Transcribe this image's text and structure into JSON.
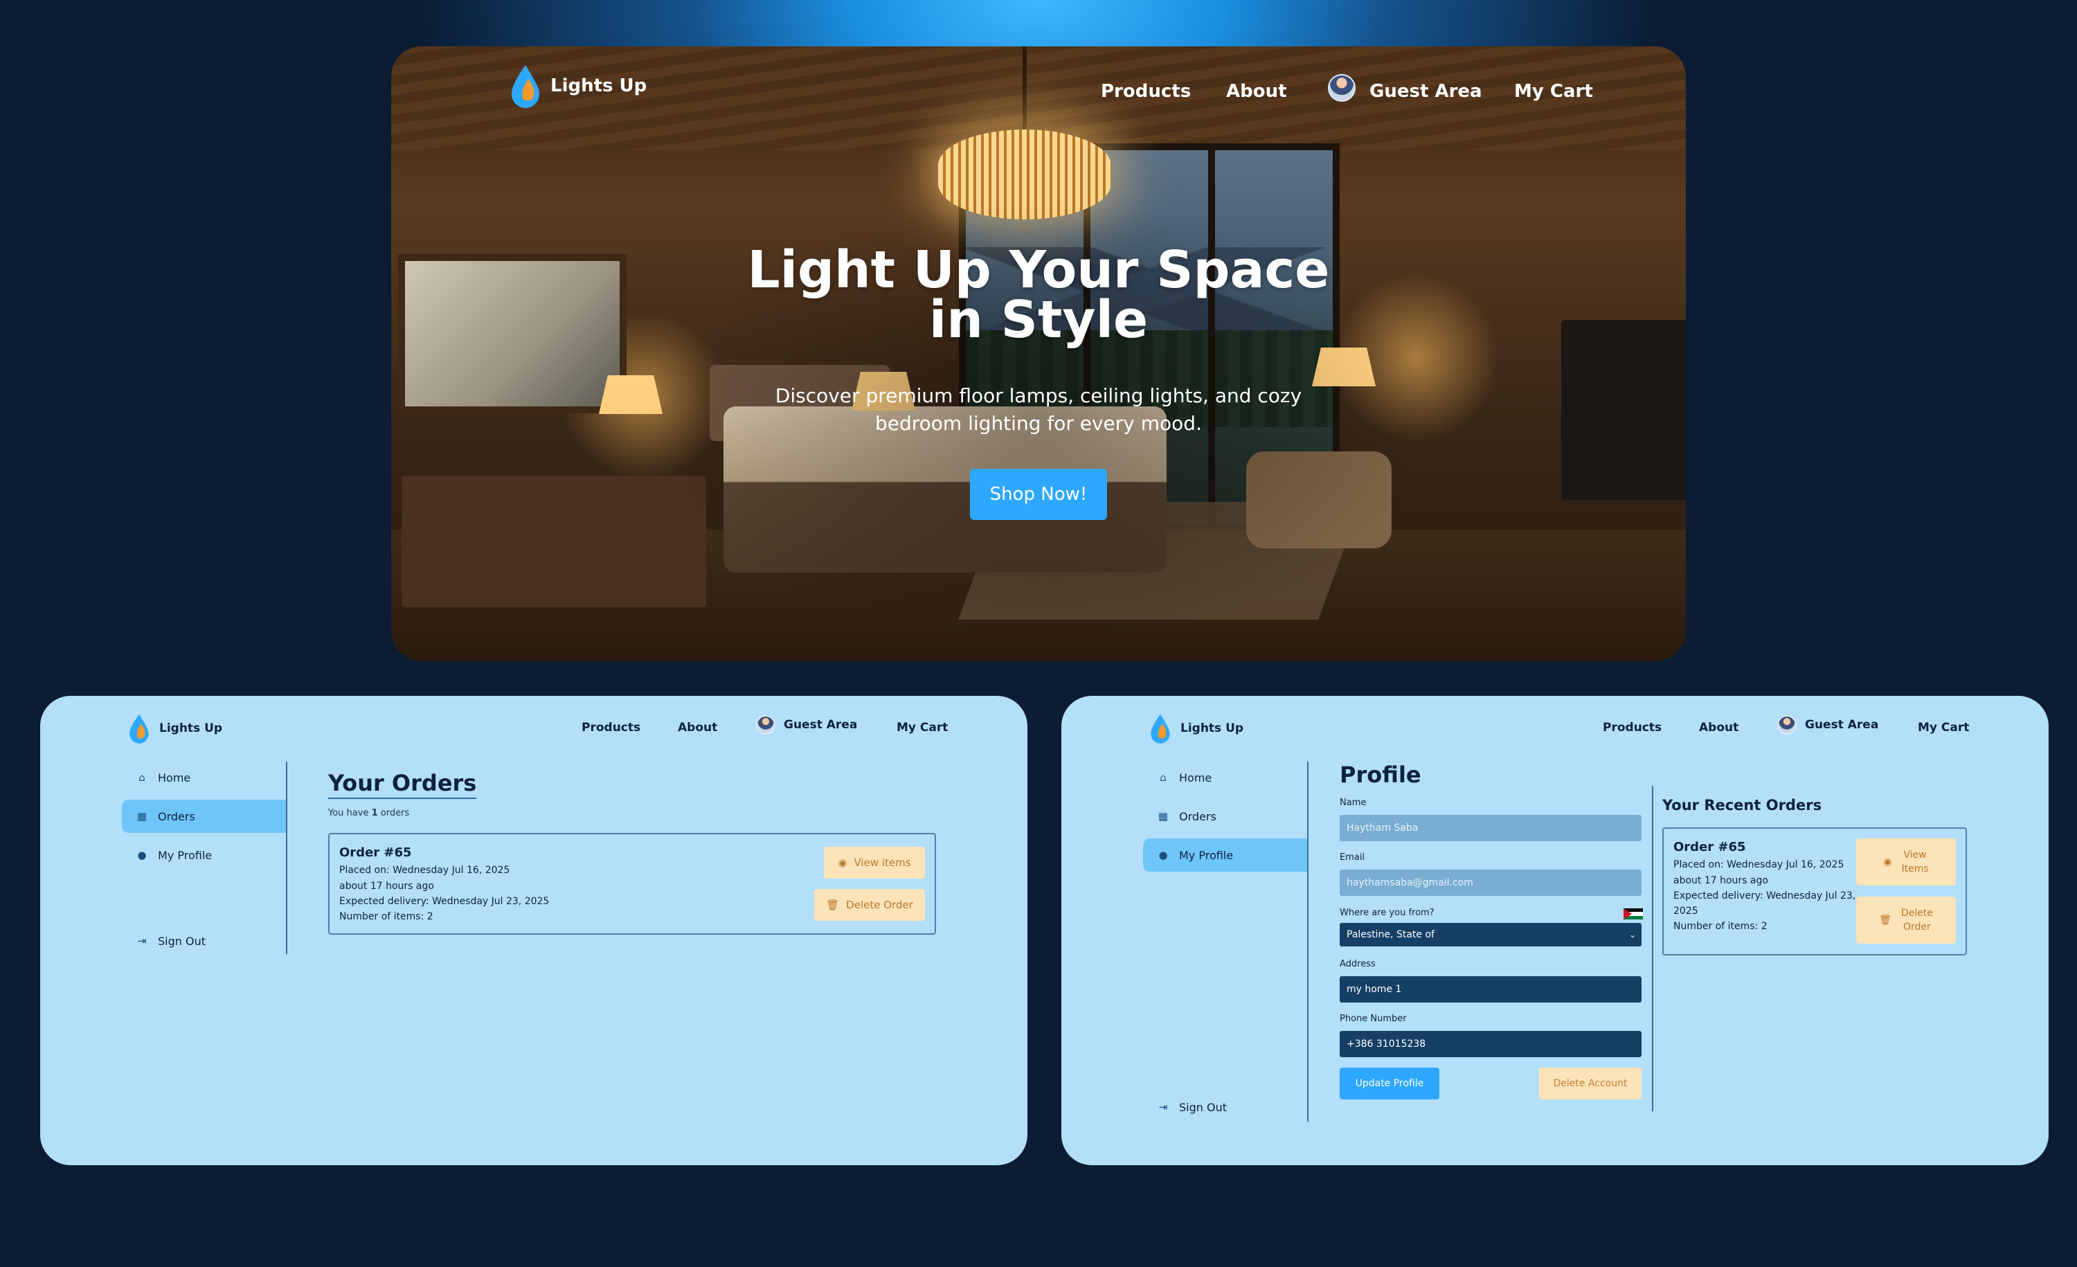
{
  "brand": {
    "name": "Lights Up"
  },
  "nav": {
    "products": "Products",
    "about": "About",
    "guest": "Guest Area",
    "cart": "My Cart"
  },
  "hero": {
    "title_line1": "Light Up Your Space",
    "title_line2": "in Style",
    "subtitle_line1": "Discover premium floor lamps, ceiling lights, and cozy",
    "subtitle_line2": "bedroom lighting for every mood.",
    "cta": "Shop Now!"
  },
  "sidebar": {
    "home": "Home",
    "orders": "Orders",
    "profile": "My Profile",
    "signout": "Sign Out"
  },
  "orders_page": {
    "heading": "Your Orders",
    "count_prefix": "You have ",
    "count": "1",
    "count_suffix": " orders",
    "order": {
      "title": "Order #65",
      "placed": "Placed on: Wednesday Jul 16, 2025",
      "ago": "about 17 hours ago",
      "expected": "Expected delivery: Wednesday Jul 23, 2025",
      "items": "Number of items: 2",
      "view_btn": "View items",
      "delete_btn": "Delete Order"
    }
  },
  "profile_page": {
    "heading": "Profile",
    "name_label": "Name",
    "name_value": "Haytham Saba",
    "email_label": "Email",
    "email_value": "haythamsaba@gmail.com",
    "country_label": "Where are you from?",
    "country_value": "Palestine, State of",
    "address_label": "Address",
    "address_value": "my home 1",
    "phone_label": "Phone Number",
    "phone_value": "+386 31015238",
    "update_btn": "Update Profile",
    "delete_btn": "Delete Account",
    "recent_heading": "Your Recent Orders",
    "recent_order": {
      "title": "Order #65",
      "placed": "Placed on: Wednesday Jul 16, 2025",
      "ago": "about 17 hours ago",
      "expected_1": "Expected delivery: Wednesday Jul 23,",
      "expected_2": "2025",
      "items": "Number of items: 2",
      "view_1": "View",
      "view_2": "Items",
      "delete_1": "Delete",
      "delete_2": "Order"
    }
  },
  "colors": {
    "accent": "#2ea8ff",
    "panel_bg": "#b3dffa",
    "dark_field": "#163f66",
    "warn_btn": "#fde3b8"
  }
}
